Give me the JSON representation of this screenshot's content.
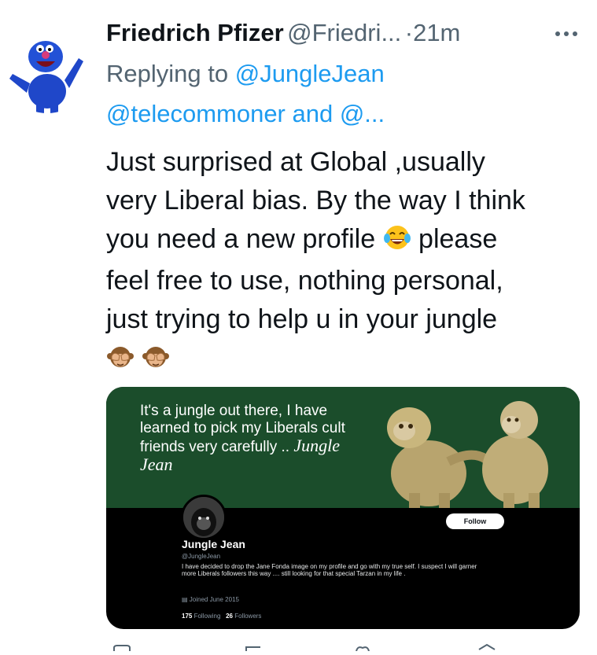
{
  "tweet": {
    "author_name": "Friedrich Pfizer",
    "author_handle": "@Friedri...",
    "separator": "·",
    "time": "21m",
    "replying_to_prefix": "Replying to",
    "reply_user_1": "@JungleJean",
    "reply_user_2_and_more": "@telecommoner and @...",
    "text_lines": [
      "Just surprised at Global ,usually",
      "very Liberal bias. By the way I think",
      "you need a new profile",
      "please",
      "feel free to use, nothing personal,",
      "just trying to help u in your jungle"
    ]
  },
  "icons": {
    "avatar": "blue-furry-muppet-avatar",
    "more": "more-horizontal-icon",
    "laugh": "tears-of-joy-emoji",
    "monkey": "see-no-evil-monkey-emoji"
  },
  "attached_image": {
    "banner_quote": "It's a jungle out there, I have learned to pick my Liberals cult friends very carefully ..",
    "banner_signature": "Jungle Jean",
    "follow_label": "Follow",
    "profile_name": "Jungle Jean",
    "profile_handle": "@JungleJean",
    "profile_bio": "I have decided to drop the Jane Fonda image on my profile and go with my true self. I suspect I will garner more Liberals followers this way .... still looking for that special Tarzan in my life .",
    "joined": "Joined June 2015",
    "following_count": "175",
    "following_label": "Following",
    "followers_count": "26",
    "followers_label": "Followers"
  },
  "colors": {
    "text": "#0f1419",
    "secondary": "#536471",
    "link": "#1d9bf0",
    "banner_green": "#1b4d2b"
  }
}
